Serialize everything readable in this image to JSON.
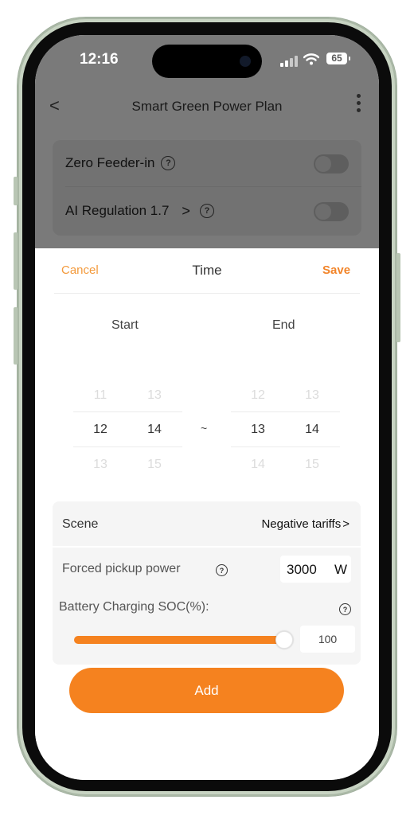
{
  "status_bar": {
    "time": "12:16",
    "battery": "65"
  },
  "header": {
    "title": "Smart Green Power Plan"
  },
  "settings": [
    {
      "label": "Zero Feeder-in",
      "enabled": false
    },
    {
      "label": "AI Regulation 1.7",
      "enabled": false
    }
  ],
  "sheet": {
    "cancel": "Cancel",
    "title": "Time",
    "save": "Save",
    "start_label": "Start",
    "end_label": "End",
    "separator": "~",
    "start_hours": {
      "prev": "11",
      "selected": "12",
      "next": "13"
    },
    "start_minutes": {
      "prev": "13",
      "selected": "14",
      "next": "15"
    },
    "end_hours": {
      "prev": "12",
      "selected": "13",
      "next": "14"
    },
    "end_minutes": {
      "prev": "13",
      "selected": "14",
      "next": "15"
    }
  },
  "options": {
    "scene_label": "Scene",
    "scene_value": "Negative tariffs",
    "power_label": "Forced pickup power",
    "power_value": "3000",
    "power_unit": "W",
    "soc_label": "Battery Charging SOC(%):",
    "soc_value": "100"
  },
  "add_button": "Add",
  "icons": {
    "help": "?",
    "chevron": ">",
    "back": "<"
  },
  "colors": {
    "accent": "#f5821f",
    "overlay": "#7a7a7a"
  }
}
